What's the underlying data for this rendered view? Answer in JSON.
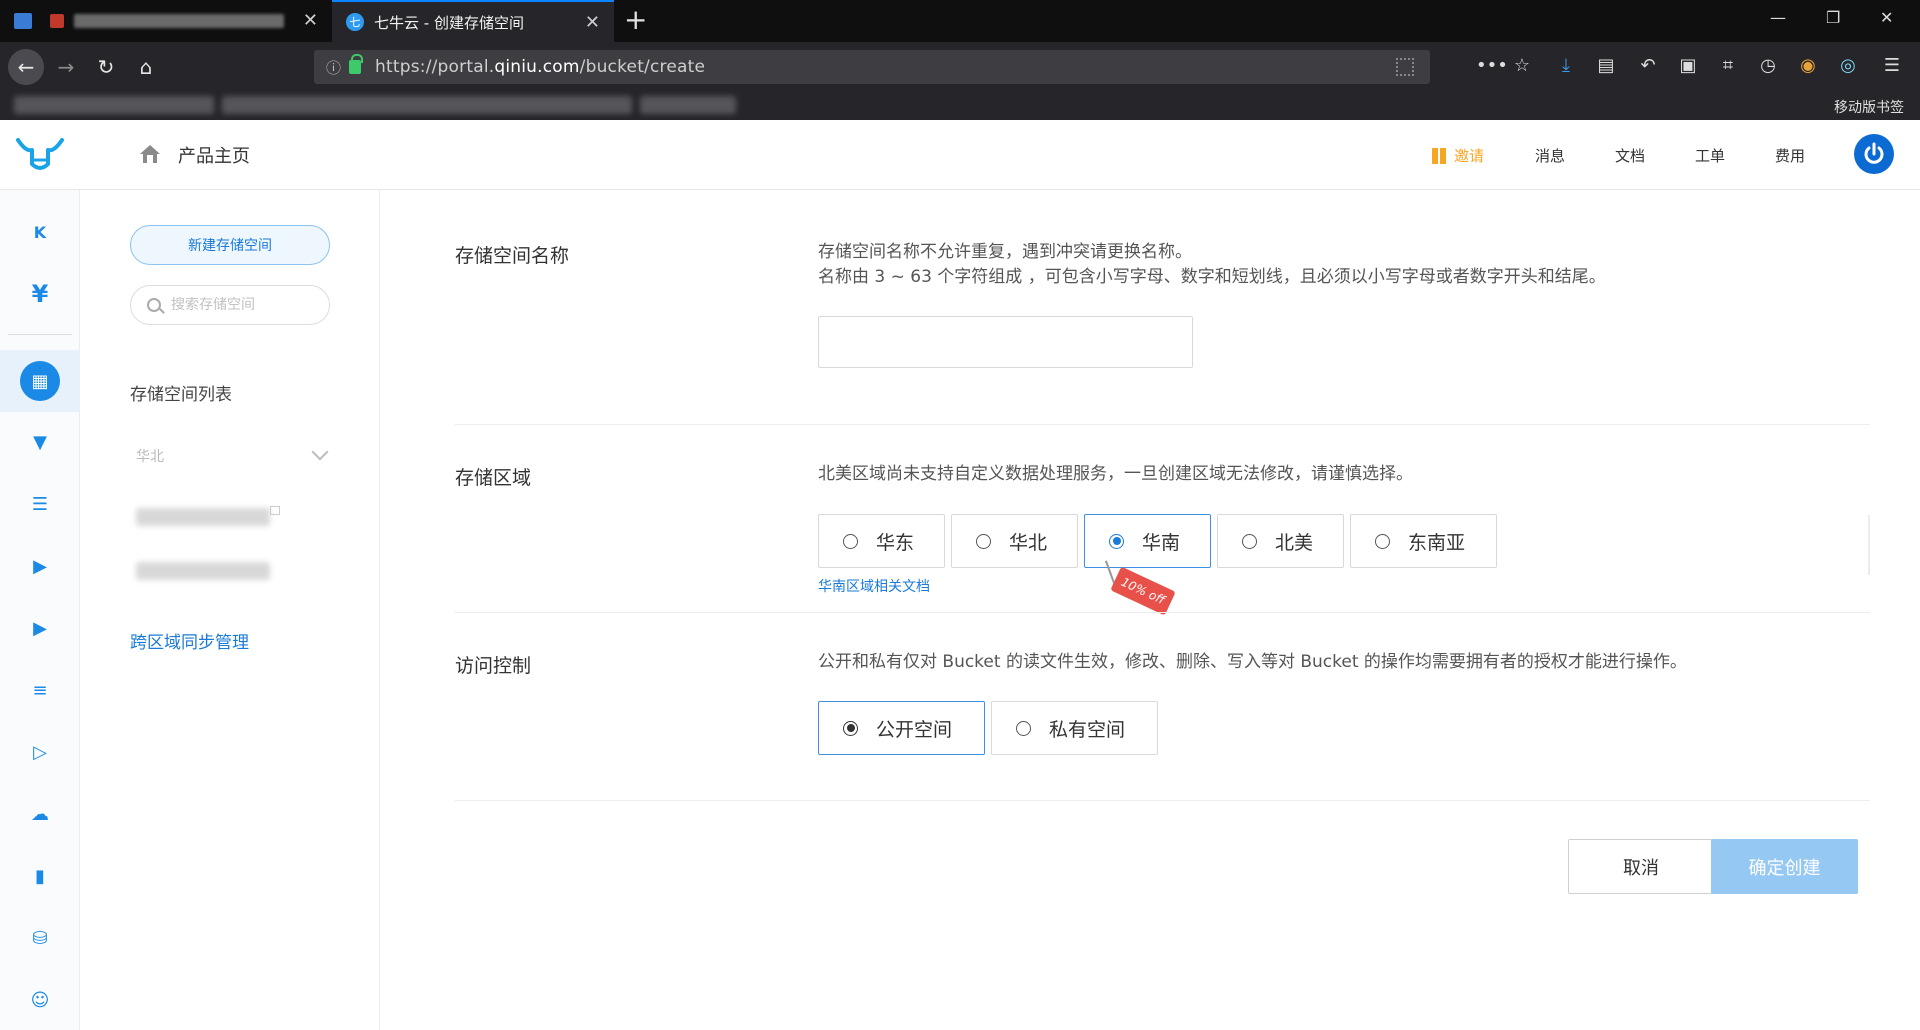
{
  "browser": {
    "tabs": [
      {
        "label": "",
        "active": false
      },
      {
        "label": "七牛云 - 创建存储空间",
        "active": true
      }
    ],
    "url_prefix": "https://portal.",
    "url_domain": "qiniu.com",
    "url_path": "/bucket/create",
    "mobile_bookmarks": "移动版书签"
  },
  "header": {
    "home_label": "产品主页",
    "nav": {
      "invite": "邀请",
      "messages": "消息",
      "docs": "文档",
      "tickets": "工单",
      "billing": "费用"
    },
    "colors": {
      "brand_blue": "#1a7ad9",
      "invite_orange": "#f5a623",
      "power_blue": "#0b6bd3"
    }
  },
  "rail": {
    "icons": [
      "kodo-logo-icon",
      "yuan-icon",
      "storage-grid-icon",
      "cdn-funnel-icon",
      "server-icon",
      "live-tv-icon",
      "video-icon",
      "sliders-icon",
      "media-play-icon",
      "cloud-icon",
      "book-icon",
      "database-icon",
      "smile-icon"
    ],
    "yuan_glyph": "¥"
  },
  "sidebar": {
    "new_bucket": "新建存储空间",
    "search_placeholder": "搜索存储空间",
    "list_title": "存储空间列表",
    "region_filter": "华北",
    "cross_region_sync": "跨区域同步管理"
  },
  "form": {
    "name": {
      "label": "存储空间名称",
      "hint1": "存储空间名称不允许重复，遇到冲突请更换名称。",
      "hint2": "名称由 3 ~ 63 个字符组成 ，可包含小写字母、数字和短划线，且必须以小写字母或者数字开头和结尾。",
      "value": ""
    },
    "region": {
      "label": "存储区域",
      "hint": "北美区域尚未支持自定义数据处理服务，一旦创建区域无法修改，请谨慎选择。",
      "options": [
        "华东",
        "华北",
        "华南",
        "北美",
        "东南亚"
      ],
      "selected": "华南",
      "doc_link": "华南区域相关文档",
      "promo": "10% off"
    },
    "access": {
      "label": "访问控制",
      "hint": "公开和私有仅对 Bucket 的读文件生效，修改、删除、写入等对 Bucket 的操作均需要拥有者的授权才能进行操作。",
      "options": [
        "公开空间",
        "私有空间"
      ],
      "selected": "公开空间"
    },
    "cancel": "取消",
    "confirm": "确定创建"
  }
}
